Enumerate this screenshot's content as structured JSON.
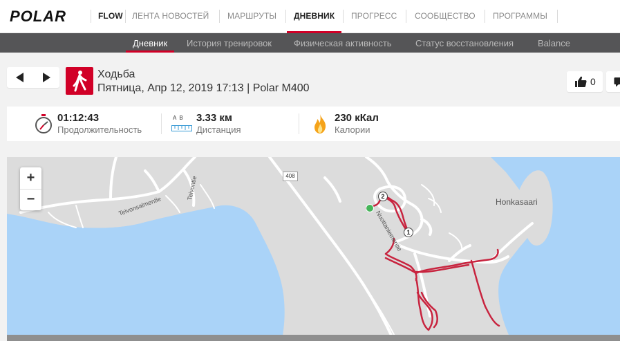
{
  "topnav": {
    "logo_text": "POLAR",
    "flow": "FLOW",
    "items": [
      {
        "label": "ЛЕНТА НОВОСТЕЙ"
      },
      {
        "label": "МАРШРУТЫ"
      },
      {
        "label": "ДНЕВНИК"
      },
      {
        "label": "ПРОГРЕСС"
      },
      {
        "label": "СООБЩЕСТВО"
      },
      {
        "label": "ПРОГРАММЫ"
      }
    ],
    "active": "ДНЕВНИК"
  },
  "subnav": {
    "items": [
      {
        "label": "Дневник"
      },
      {
        "label": "История тренировок"
      },
      {
        "label": "Физическая активность"
      },
      {
        "label": "Статус восстановления"
      },
      {
        "label": "Balance"
      }
    ],
    "active": "Дневник"
  },
  "session": {
    "sport": "Ходьба",
    "details": "Пятница, Апр 12, 2019 17:13 | Polar M400",
    "likes": "0"
  },
  "stats": {
    "duration_value": "01:12:43",
    "duration_label": "Продолжительность",
    "distance_ab": "A  B",
    "distance_value": "3.33 км",
    "distance_label": "Дистанция",
    "calories_value": "230 кКал",
    "calories_label": "Калории"
  },
  "map": {
    "zoom_in": "+",
    "zoom_out": "−",
    "labels": {
      "street1": "Teivonsalmentie",
      "street2": "Teivontie",
      "street3": "Nuottaniementie",
      "island": "Honkasaari",
      "road_number": "408"
    },
    "markers": {
      "m1": "1",
      "m2": "2"
    },
    "colors": {
      "water": "#aad3f8",
      "land": "#dadada",
      "route": "#c8243f",
      "accent": "#d10027"
    }
  }
}
